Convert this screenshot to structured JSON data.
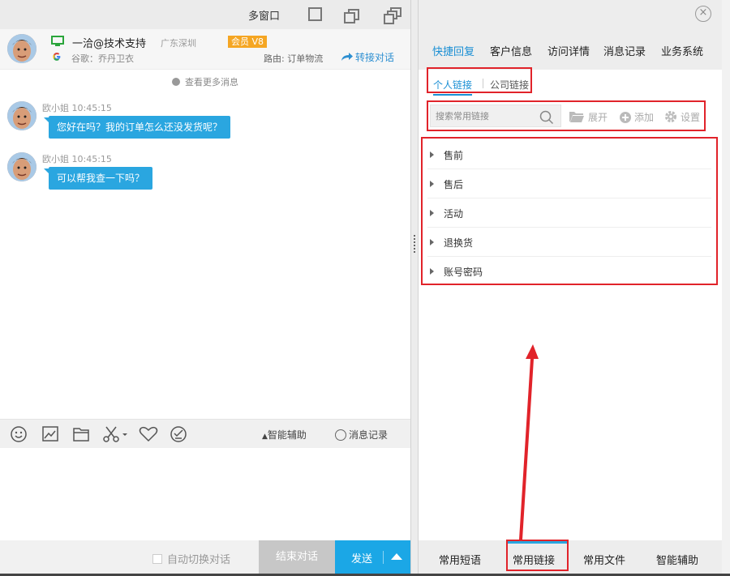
{
  "window": {
    "multi_window_label": "多窗口"
  },
  "customer": {
    "name": "一洽@技术支持",
    "location": "广东深圳",
    "member_badge": "会员 V8",
    "source": "谷歌：乔丹卫衣",
    "route": "路由: 订单物流",
    "transfer_label": "转接对话"
  },
  "chat": {
    "more_history": "查看更多消息",
    "messages": [
      {
        "sender": "欧小姐",
        "time": "10:45:15",
        "text": "您好在吗？我的订单怎么还没发货呢？"
      },
      {
        "sender": "欧小姐",
        "time": "10:45:15",
        "text": "可以帮我查一下吗？"
      }
    ]
  },
  "toolbar": {
    "tools": [
      "smile-icon",
      "image-icon",
      "folder-icon",
      "scissors-icon",
      "heart-icon",
      "rate-icon"
    ],
    "assist_label": "智能辅助",
    "records_label": "消息记录"
  },
  "bottom": {
    "auto_switch_label": "自动切换对话",
    "end_label": "结束对话",
    "send_label": "发送"
  },
  "right_panel": {
    "tabs": [
      "快捷回复",
      "客户信息",
      "访问详情",
      "消息记录",
      "业务系统"
    ],
    "active_tab": "快捷回复",
    "subtabs": [
      "个人链接",
      "公司链接"
    ],
    "active_subtab": "个人链接",
    "search_placeholder": "搜索常用链接",
    "actions": {
      "expand": "展开",
      "add": "添加",
      "settings": "设置"
    },
    "categories": [
      "售前",
      "售后",
      "活动",
      "退换货",
      "账号密码"
    ],
    "bottom_tabs": [
      "常用短语",
      "常用链接",
      "常用文件",
      "智能辅助"
    ],
    "active_bottom_tab": "常用链接"
  },
  "colors": {
    "accent": "#1ba7e6",
    "bubble": "#2aa6e0",
    "highlight": "#e1232a",
    "badge": "#f5a623"
  }
}
